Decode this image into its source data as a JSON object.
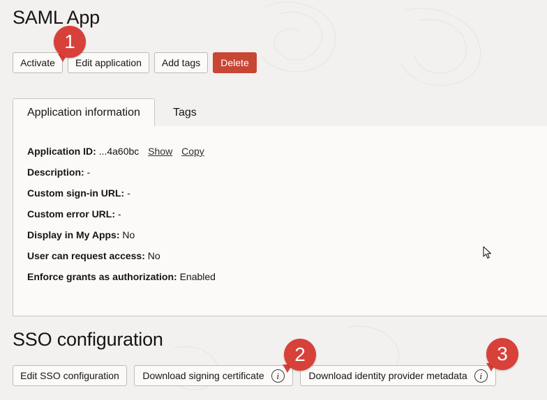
{
  "page": {
    "title": "SAML App"
  },
  "toolbar": {
    "activate_label": "Activate",
    "edit_label": "Edit application",
    "add_tags_label": "Add tags",
    "delete_label": "Delete"
  },
  "tabs": [
    {
      "label": "Application information",
      "active": true
    },
    {
      "label": "Tags",
      "active": false
    }
  ],
  "app_info": {
    "id_label": "Application ID:",
    "id_value": "...4a60bc",
    "show_link": "Show",
    "copy_link": "Copy",
    "rows": [
      {
        "label": "Description:",
        "value": "-"
      },
      {
        "label": "Custom sign-in URL:",
        "value": "-"
      },
      {
        "label": "Custom error URL:",
        "value": "-"
      },
      {
        "label": "Display in My Apps:",
        "value": "No"
      },
      {
        "label": "User can request access:",
        "value": "No"
      },
      {
        "label": "Enforce grants as authorization:",
        "value": "Enabled"
      }
    ]
  },
  "sso": {
    "title": "SSO configuration",
    "edit_label": "Edit SSO configuration",
    "download_cert_label": "Download signing certificate",
    "download_metadata_label": "Download identity provider metadata",
    "info_glyph": "i"
  },
  "annotations": [
    {
      "number": "1"
    },
    {
      "number": "2"
    },
    {
      "number": "3"
    }
  ],
  "colors": {
    "background": "#f2f1ef",
    "panel": "#fbfaf9",
    "danger": "#c74634",
    "badge": "#d8403a",
    "text": "#161513"
  },
  "icons": [
    "info-icon",
    "mouse-cursor-icon"
  ]
}
